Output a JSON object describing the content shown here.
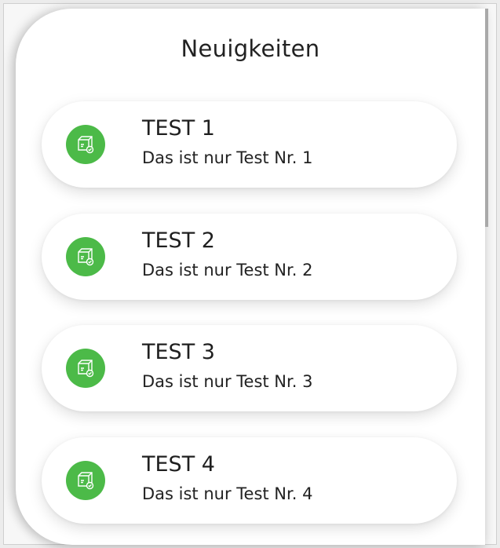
{
  "header": {
    "title": "Neuigkeiten"
  },
  "colors": {
    "accent": "#4cba48"
  },
  "news": [
    {
      "title": "TEST 1",
      "text": "Das ist nur Test Nr. 1",
      "icon": "package-check-icon"
    },
    {
      "title": "TEST 2",
      "text": "Das ist nur Test Nr. 2",
      "icon": "package-check-icon"
    },
    {
      "title": "TEST 3",
      "text": "Das ist nur Test Nr. 3",
      "icon": "package-check-icon"
    },
    {
      "title": "TEST 4",
      "text": "Das ist nur Test Nr. 4",
      "icon": "package-check-icon"
    }
  ]
}
